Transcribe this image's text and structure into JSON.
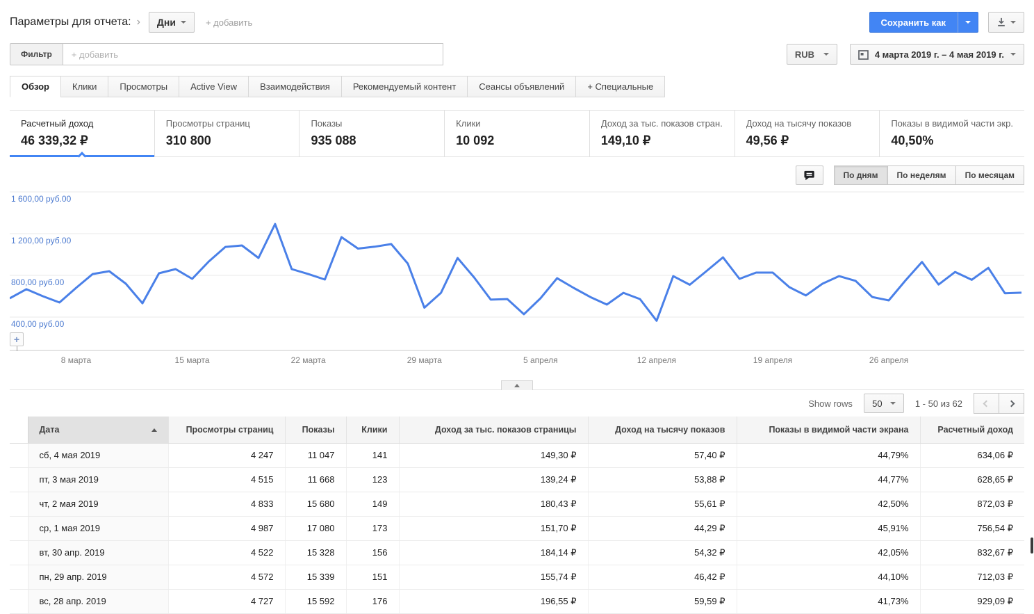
{
  "header": {
    "title": "Параметры для отчета:",
    "dimension_button": "Дни",
    "add_dimension": "+ добавить",
    "save_as": "Сохранить как"
  },
  "filter": {
    "button_label": "Фильтр",
    "placeholder": "+ добавить"
  },
  "toolbar_right": {
    "currency": "RUB",
    "date_range": "4 марта 2019 г. – 4 мая 2019 г."
  },
  "tabs": [
    {
      "label": "Обзор",
      "active": true
    },
    {
      "label": "Клики",
      "active": false
    },
    {
      "label": "Просмотры",
      "active": false
    },
    {
      "label": "Active View",
      "active": false
    },
    {
      "label": "Взаимодействия",
      "active": false
    },
    {
      "label": "Рекомендуемый контент",
      "active": false
    },
    {
      "label": "Сеансы объявлений",
      "active": false
    },
    {
      "label": "+ Специальные",
      "active": false
    }
  ],
  "metrics": [
    {
      "label": "Расчетный доход",
      "value": "46 339,32 ₽",
      "active": true
    },
    {
      "label": "Просмотры страниц",
      "value": "310 800",
      "active": false
    },
    {
      "label": "Показы",
      "value": "935 088",
      "active": false
    },
    {
      "label": "Клики",
      "value": "10 092",
      "active": false
    },
    {
      "label": "Доход за тыс. показов стран...",
      "value": "149,10 ₽",
      "active": false
    },
    {
      "label": "Доход на тысячу показов",
      "value": "49,56 ₽",
      "active": false
    },
    {
      "label": "Показы в видимой части экр...",
      "value": "40,50%",
      "active": false
    }
  ],
  "chart_controls": {
    "options": [
      {
        "label": "По дням",
        "active": true
      },
      {
        "label": "По неделям",
        "active": false
      },
      {
        "label": "По месяцам",
        "active": false
      }
    ]
  },
  "chart_data": {
    "type": "line",
    "series_name": "Расчетный доход",
    "unit": "RUB",
    "x_range": [
      "4 марта 2019",
      "4 мая 2019"
    ],
    "x_tick_labels": [
      "8 марта",
      "15 марта",
      "22 марта",
      "29 марта",
      "5 апреля",
      "12 апреля",
      "19 апреля",
      "26 апреля"
    ],
    "x_tick_day_indices": [
      4,
      11,
      18,
      25,
      32,
      39,
      46,
      53
    ],
    "y_tick_values": [
      400,
      800,
      1200,
      1600
    ],
    "y_tick_labels": [
      "400,00 руб.00",
      "800,00 руб.00",
      "1 200,00 руб.00",
      "1 600,00 руб.00"
    ],
    "ylim": [
      0,
      1650
    ],
    "grid": true,
    "legend": "none",
    "line_color": "#4a80e8",
    "values": [
      580,
      667,
      600,
      540,
      680,
      813,
      840,
      720,
      533,
      820,
      860,
      767,
      933,
      1073,
      1087,
      967,
      1293,
      860,
      813,
      760,
      1167,
      1057,
      1075,
      1100,
      913,
      490,
      633,
      967,
      780,
      567,
      573,
      427,
      580,
      773,
      680,
      593,
      520,
      633,
      573,
      365,
      793,
      710,
      840,
      973,
      767,
      827,
      827,
      687,
      607,
      720,
      793,
      747,
      593,
      560,
      750,
      929,
      712,
      833,
      757,
      872,
      629,
      634
    ]
  },
  "table": {
    "show_rows_label": "Show rows",
    "rows_per_page": "50",
    "pagination": "1 - 50 из 62",
    "sorted_column": "Дата",
    "sort_direction": "ascending",
    "columns": [
      "Дата",
      "Просмотры страниц",
      "Показы",
      "Клики",
      "Доход за тыс. показов страницы",
      "Доход на тысячу показов",
      "Показы в видимой части экрана",
      "Расчетный доход"
    ],
    "rows": [
      [
        "сб, 4 мая 2019",
        "4 247",
        "11 047",
        "141",
        "149,30 ₽",
        "57,40 ₽",
        "44,79%",
        "634,06 ₽"
      ],
      [
        "пт, 3 мая 2019",
        "4 515",
        "11 668",
        "123",
        "139,24 ₽",
        "53,88 ₽",
        "44,77%",
        "628,65 ₽"
      ],
      [
        "чт, 2 мая 2019",
        "4 833",
        "15 680",
        "149",
        "180,43 ₽",
        "55,61 ₽",
        "42,50%",
        "872,03 ₽"
      ],
      [
        "ср, 1 мая 2019",
        "4 987",
        "17 080",
        "173",
        "151,70 ₽",
        "44,29 ₽",
        "45,91%",
        "756,54 ₽"
      ],
      [
        "вт, 30 апр. 2019",
        "4 522",
        "15 328",
        "156",
        "184,14 ₽",
        "54,32 ₽",
        "42,05%",
        "832,67 ₽"
      ],
      [
        "пн, 29 апр. 2019",
        "4 572",
        "15 339",
        "151",
        "155,74 ₽",
        "46,42 ₽",
        "44,10%",
        "712,03 ₽"
      ],
      [
        "вс, 28 апр. 2019",
        "4 727",
        "15 592",
        "176",
        "196,55 ₽",
        "59,59 ₽",
        "41,73%",
        "929,09 ₽"
      ]
    ]
  },
  "colors": {
    "accent_blue": "#4285f4",
    "chart_line": "#4a80e8",
    "axis_label_blue": "#4d7bd0"
  }
}
